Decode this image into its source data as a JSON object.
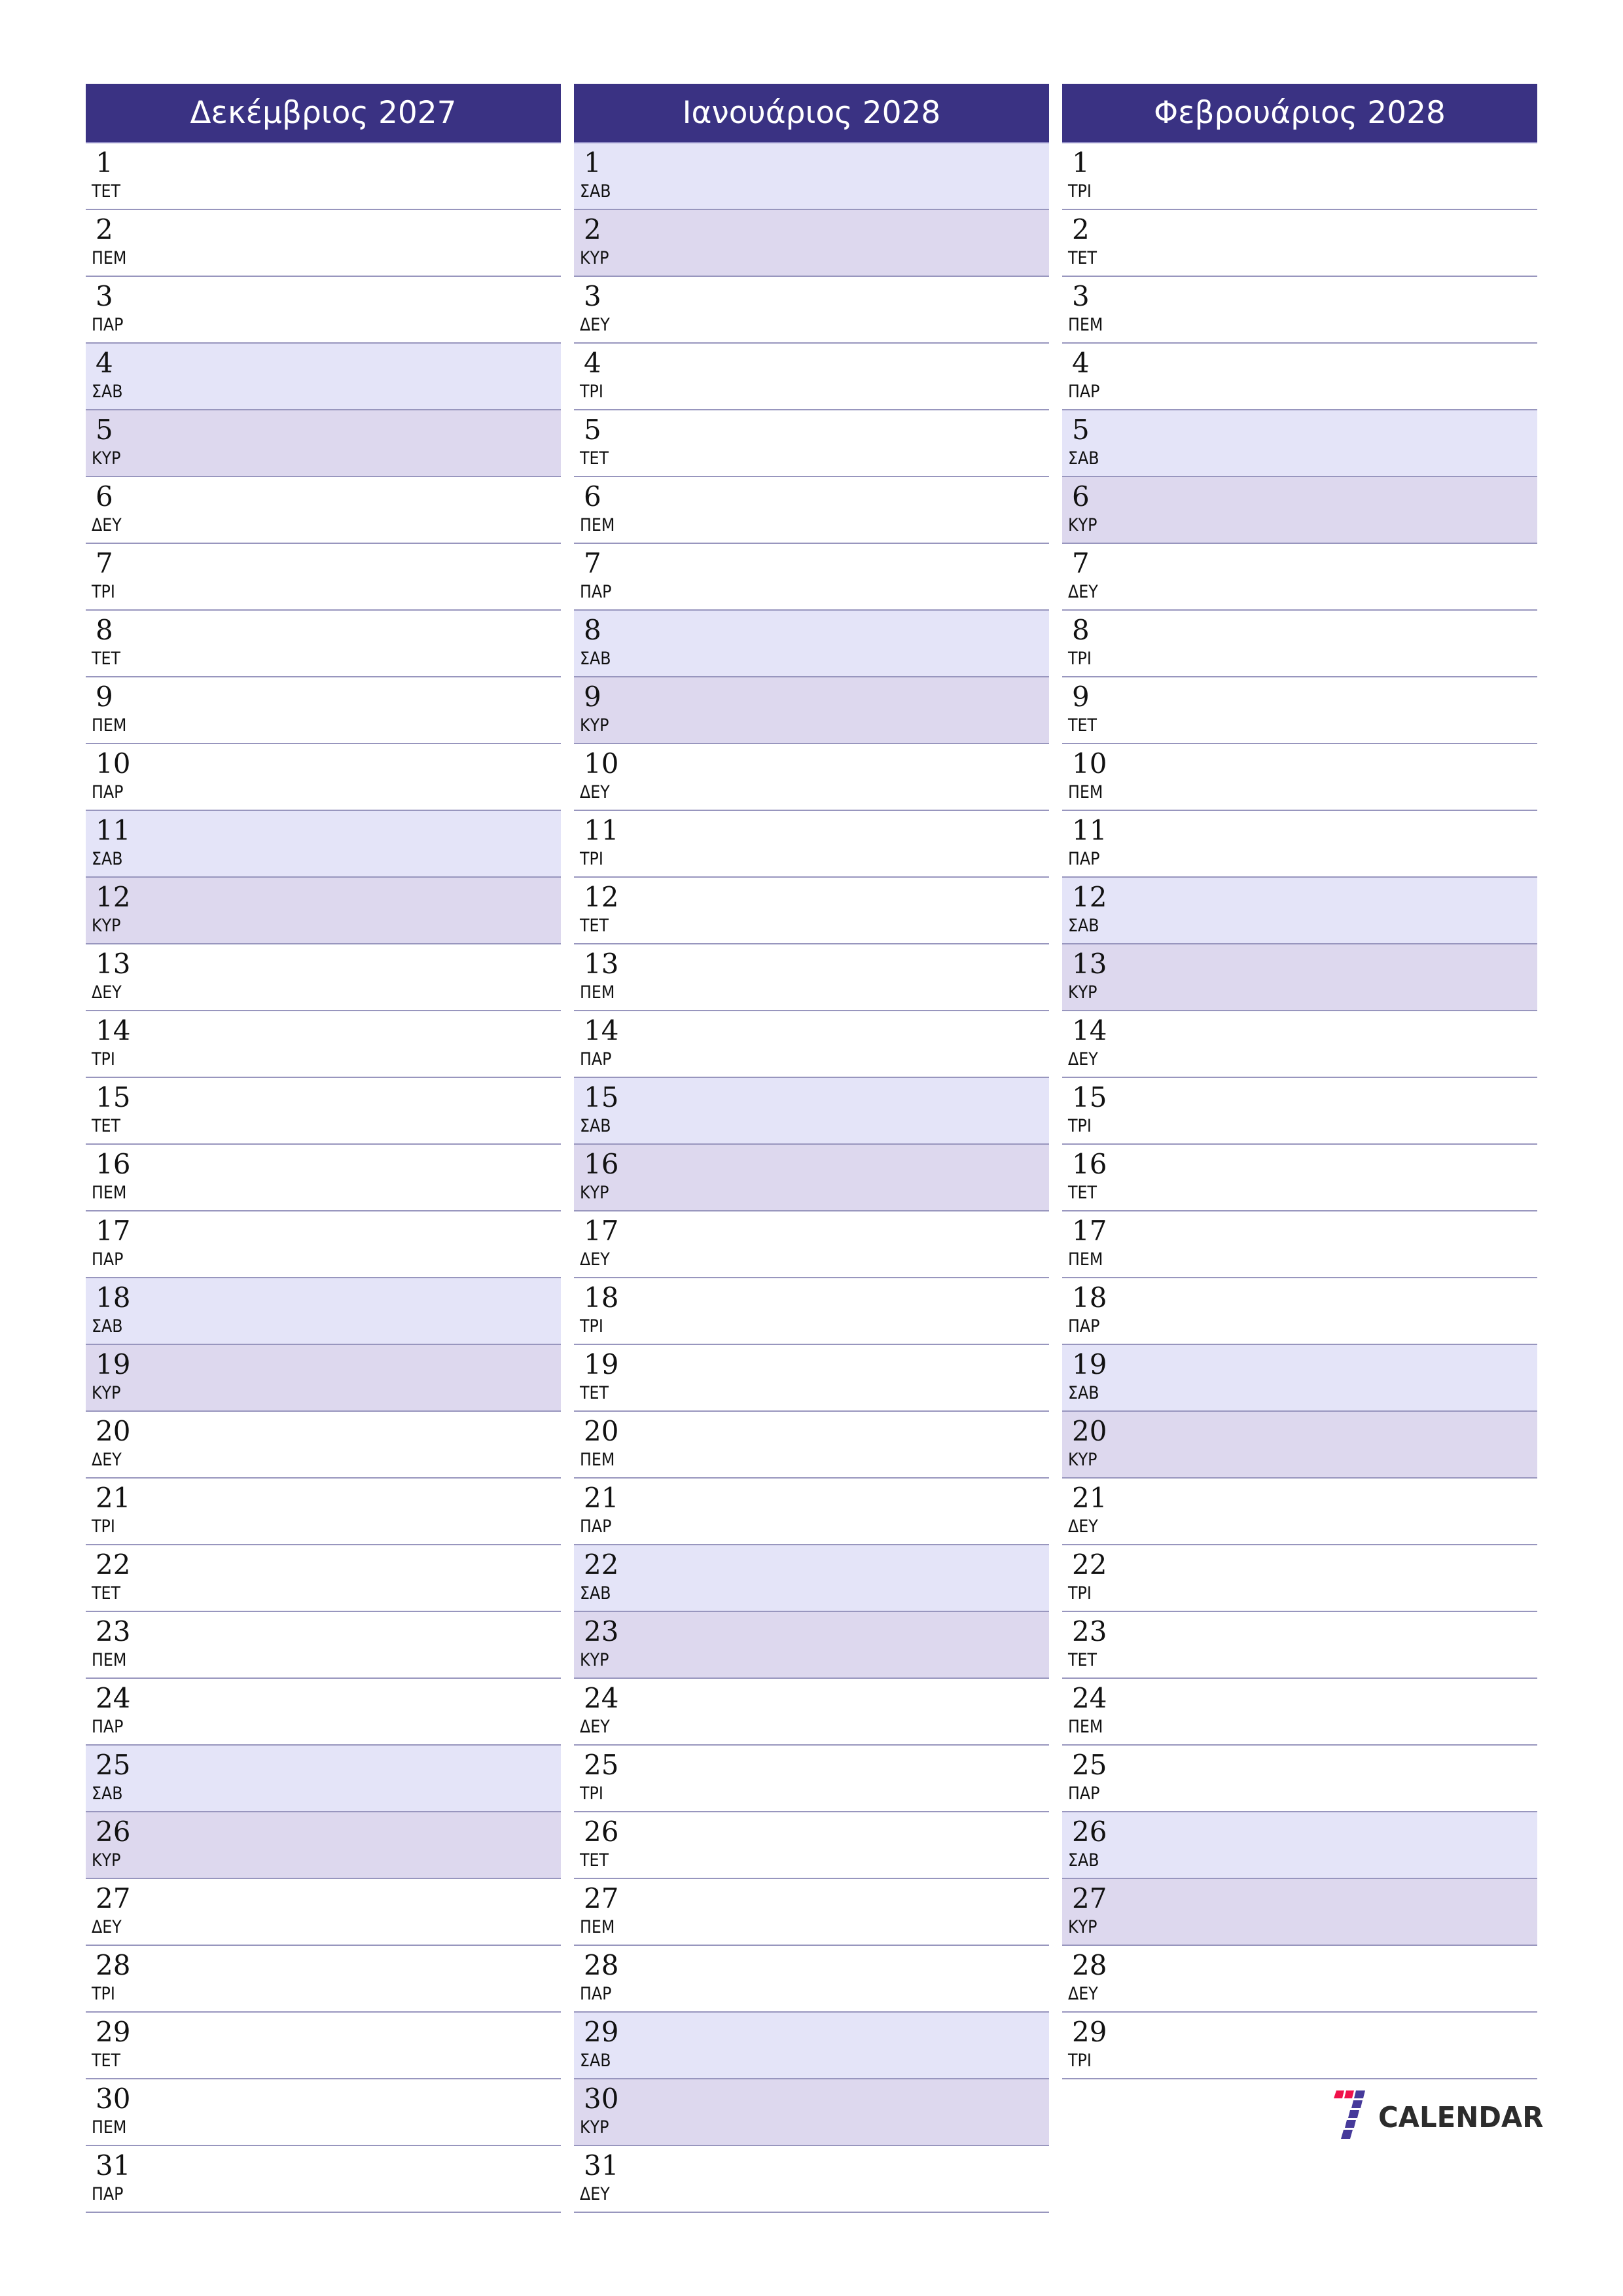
{
  "months": [
    {
      "title": "Δεκέμβριος 2027",
      "days": [
        {
          "n": "1",
          "wd": "ΤΕΤ",
          "type": "weekday"
        },
        {
          "n": "2",
          "wd": "ΠΕΜ",
          "type": "weekday"
        },
        {
          "n": "3",
          "wd": "ΠΑΡ",
          "type": "weekday"
        },
        {
          "n": "4",
          "wd": "ΣΑΒ",
          "type": "sat"
        },
        {
          "n": "5",
          "wd": "ΚΥΡ",
          "type": "sun"
        },
        {
          "n": "6",
          "wd": "ΔΕΥ",
          "type": "weekday"
        },
        {
          "n": "7",
          "wd": "ΤΡΙ",
          "type": "weekday"
        },
        {
          "n": "8",
          "wd": "ΤΕΤ",
          "type": "weekday"
        },
        {
          "n": "9",
          "wd": "ΠΕΜ",
          "type": "weekday"
        },
        {
          "n": "10",
          "wd": "ΠΑΡ",
          "type": "weekday"
        },
        {
          "n": "11",
          "wd": "ΣΑΒ",
          "type": "sat"
        },
        {
          "n": "12",
          "wd": "ΚΥΡ",
          "type": "sun"
        },
        {
          "n": "13",
          "wd": "ΔΕΥ",
          "type": "weekday"
        },
        {
          "n": "14",
          "wd": "ΤΡΙ",
          "type": "weekday"
        },
        {
          "n": "15",
          "wd": "ΤΕΤ",
          "type": "weekday"
        },
        {
          "n": "16",
          "wd": "ΠΕΜ",
          "type": "weekday"
        },
        {
          "n": "17",
          "wd": "ΠΑΡ",
          "type": "weekday"
        },
        {
          "n": "18",
          "wd": "ΣΑΒ",
          "type": "sat"
        },
        {
          "n": "19",
          "wd": "ΚΥΡ",
          "type": "sun"
        },
        {
          "n": "20",
          "wd": "ΔΕΥ",
          "type": "weekday"
        },
        {
          "n": "21",
          "wd": "ΤΡΙ",
          "type": "weekday"
        },
        {
          "n": "22",
          "wd": "ΤΕΤ",
          "type": "weekday"
        },
        {
          "n": "23",
          "wd": "ΠΕΜ",
          "type": "weekday"
        },
        {
          "n": "24",
          "wd": "ΠΑΡ",
          "type": "weekday"
        },
        {
          "n": "25",
          "wd": "ΣΑΒ",
          "type": "sat"
        },
        {
          "n": "26",
          "wd": "ΚΥΡ",
          "type": "sun"
        },
        {
          "n": "27",
          "wd": "ΔΕΥ",
          "type": "weekday"
        },
        {
          "n": "28",
          "wd": "ΤΡΙ",
          "type": "weekday"
        },
        {
          "n": "29",
          "wd": "ΤΕΤ",
          "type": "weekday"
        },
        {
          "n": "30",
          "wd": "ΠΕΜ",
          "type": "weekday"
        },
        {
          "n": "31",
          "wd": "ΠΑΡ",
          "type": "weekday"
        }
      ]
    },
    {
      "title": "Ιανουάριος 2028",
      "days": [
        {
          "n": "1",
          "wd": "ΣΑΒ",
          "type": "sat"
        },
        {
          "n": "2",
          "wd": "ΚΥΡ",
          "type": "sun"
        },
        {
          "n": "3",
          "wd": "ΔΕΥ",
          "type": "weekday"
        },
        {
          "n": "4",
          "wd": "ΤΡΙ",
          "type": "weekday"
        },
        {
          "n": "5",
          "wd": "ΤΕΤ",
          "type": "weekday"
        },
        {
          "n": "6",
          "wd": "ΠΕΜ",
          "type": "weekday"
        },
        {
          "n": "7",
          "wd": "ΠΑΡ",
          "type": "weekday"
        },
        {
          "n": "8",
          "wd": "ΣΑΒ",
          "type": "sat"
        },
        {
          "n": "9",
          "wd": "ΚΥΡ",
          "type": "sun"
        },
        {
          "n": "10",
          "wd": "ΔΕΥ",
          "type": "weekday"
        },
        {
          "n": "11",
          "wd": "ΤΡΙ",
          "type": "weekday"
        },
        {
          "n": "12",
          "wd": "ΤΕΤ",
          "type": "weekday"
        },
        {
          "n": "13",
          "wd": "ΠΕΜ",
          "type": "weekday"
        },
        {
          "n": "14",
          "wd": "ΠΑΡ",
          "type": "weekday"
        },
        {
          "n": "15",
          "wd": "ΣΑΒ",
          "type": "sat"
        },
        {
          "n": "16",
          "wd": "ΚΥΡ",
          "type": "sun"
        },
        {
          "n": "17",
          "wd": "ΔΕΥ",
          "type": "weekday"
        },
        {
          "n": "18",
          "wd": "ΤΡΙ",
          "type": "weekday"
        },
        {
          "n": "19",
          "wd": "ΤΕΤ",
          "type": "weekday"
        },
        {
          "n": "20",
          "wd": "ΠΕΜ",
          "type": "weekday"
        },
        {
          "n": "21",
          "wd": "ΠΑΡ",
          "type": "weekday"
        },
        {
          "n": "22",
          "wd": "ΣΑΒ",
          "type": "sat"
        },
        {
          "n": "23",
          "wd": "ΚΥΡ",
          "type": "sun"
        },
        {
          "n": "24",
          "wd": "ΔΕΥ",
          "type": "weekday"
        },
        {
          "n": "25",
          "wd": "ΤΡΙ",
          "type": "weekday"
        },
        {
          "n": "26",
          "wd": "ΤΕΤ",
          "type": "weekday"
        },
        {
          "n": "27",
          "wd": "ΠΕΜ",
          "type": "weekday"
        },
        {
          "n": "28",
          "wd": "ΠΑΡ",
          "type": "weekday"
        },
        {
          "n": "29",
          "wd": "ΣΑΒ",
          "type": "sat"
        },
        {
          "n": "30",
          "wd": "ΚΥΡ",
          "type": "sun"
        },
        {
          "n": "31",
          "wd": "ΔΕΥ",
          "type": "weekday"
        }
      ]
    },
    {
      "title": "Φεβρουάριος 2028",
      "days": [
        {
          "n": "1",
          "wd": "ΤΡΙ",
          "type": "weekday"
        },
        {
          "n": "2",
          "wd": "ΤΕΤ",
          "type": "weekday"
        },
        {
          "n": "3",
          "wd": "ΠΕΜ",
          "type": "weekday"
        },
        {
          "n": "4",
          "wd": "ΠΑΡ",
          "type": "weekday"
        },
        {
          "n": "5",
          "wd": "ΣΑΒ",
          "type": "sat"
        },
        {
          "n": "6",
          "wd": "ΚΥΡ",
          "type": "sun"
        },
        {
          "n": "7",
          "wd": "ΔΕΥ",
          "type": "weekday"
        },
        {
          "n": "8",
          "wd": "ΤΡΙ",
          "type": "weekday"
        },
        {
          "n": "9",
          "wd": "ΤΕΤ",
          "type": "weekday"
        },
        {
          "n": "10",
          "wd": "ΠΕΜ",
          "type": "weekday"
        },
        {
          "n": "11",
          "wd": "ΠΑΡ",
          "type": "weekday"
        },
        {
          "n": "12",
          "wd": "ΣΑΒ",
          "type": "sat"
        },
        {
          "n": "13",
          "wd": "ΚΥΡ",
          "type": "sun"
        },
        {
          "n": "14",
          "wd": "ΔΕΥ",
          "type": "weekday"
        },
        {
          "n": "15",
          "wd": "ΤΡΙ",
          "type": "weekday"
        },
        {
          "n": "16",
          "wd": "ΤΕΤ",
          "type": "weekday"
        },
        {
          "n": "17",
          "wd": "ΠΕΜ",
          "type": "weekday"
        },
        {
          "n": "18",
          "wd": "ΠΑΡ",
          "type": "weekday"
        },
        {
          "n": "19",
          "wd": "ΣΑΒ",
          "type": "sat"
        },
        {
          "n": "20",
          "wd": "ΚΥΡ",
          "type": "sun"
        },
        {
          "n": "21",
          "wd": "ΔΕΥ",
          "type": "weekday"
        },
        {
          "n": "22",
          "wd": "ΤΡΙ",
          "type": "weekday"
        },
        {
          "n": "23",
          "wd": "ΤΕΤ",
          "type": "weekday"
        },
        {
          "n": "24",
          "wd": "ΠΕΜ",
          "type": "weekday"
        },
        {
          "n": "25",
          "wd": "ΠΑΡ",
          "type": "weekday"
        },
        {
          "n": "26",
          "wd": "ΣΑΒ",
          "type": "sat"
        },
        {
          "n": "27",
          "wd": "ΚΥΡ",
          "type": "sun"
        },
        {
          "n": "28",
          "wd": "ΔΕΥ",
          "type": "weekday"
        },
        {
          "n": "29",
          "wd": "ΤΡΙ",
          "type": "weekday"
        }
      ]
    }
  ],
  "logo": {
    "icon": "seven-calendar-logo-icon",
    "text": "CALENDAR"
  },
  "colors": {
    "header_bg": "#3A3283",
    "header_text": "#FFFFFF",
    "saturday_bg": "#E4E4F8",
    "sunday_bg": "#DDD8EE",
    "row_border": "#9896BE",
    "logo_red": "#F0114A",
    "logo_purple": "#463A9A",
    "logo_text": "#2C2C2C"
  }
}
